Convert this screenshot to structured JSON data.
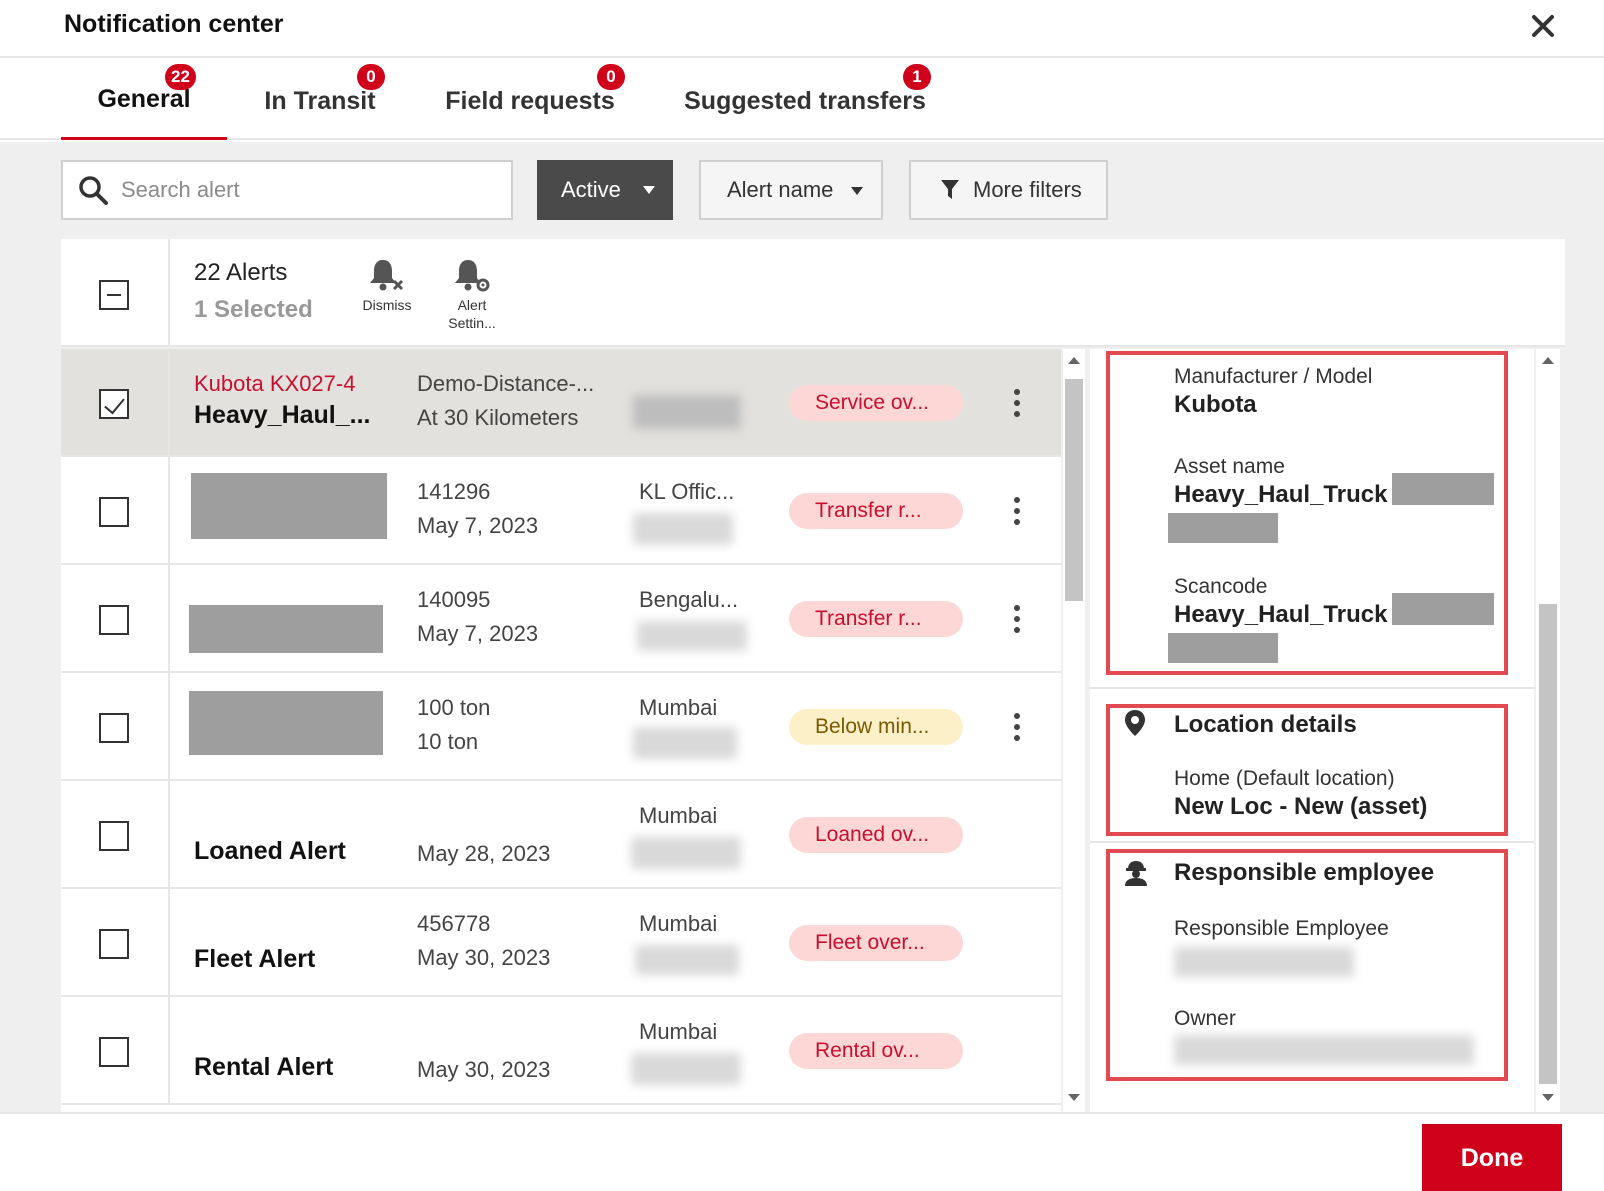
{
  "header": {
    "title": "Notification center",
    "close_icon": "close-icon"
  },
  "tabs": [
    {
      "label": "General",
      "badge": "22",
      "active": true
    },
    {
      "label": "In Transit",
      "badge": "0"
    },
    {
      "label": "Field requests",
      "badge": "0"
    },
    {
      "label": "Suggested transfers",
      "badge": "1"
    }
  ],
  "filters": {
    "search_placeholder": "Search alert",
    "status_label": "Active",
    "alert_name_label": "Alert name",
    "more_filters_label": "More filters"
  },
  "alerts_header": {
    "count": "22 Alerts",
    "selected": "1 Selected",
    "dismiss_label": "Dismiss",
    "settings_label": "Alert Settin..."
  },
  "rows": [
    {
      "title_red": "Kubota KX027-4",
      "title": "Heavy_Haul_...",
      "line1": "Demo-Distance-...",
      "line2": "At 30 Kilometers",
      "location": "",
      "status": "Service ov...",
      "status_color": "red",
      "checked": true
    },
    {
      "title": "",
      "line1": "141296",
      "line2": "May 7, 2023",
      "location": "KL Offic...",
      "status": "Transfer r...",
      "status_color": "red"
    },
    {
      "title": "",
      "line1": "140095",
      "line2": "May 7, 2023",
      "location": "Bengalu...",
      "status": "Transfer r...",
      "status_color": "red"
    },
    {
      "title": "",
      "line1": "100 ton",
      "line2": "10 ton",
      "location": "Mumbai",
      "status": "Below min...",
      "status_color": "yellow"
    },
    {
      "title": "Loaned Alert",
      "line1": "",
      "line2": "May 28, 2023",
      "location": "Mumbai",
      "status": "Loaned ov...",
      "status_color": "red"
    },
    {
      "title": "Fleet Alert",
      "line1": "456778",
      "line2": "May 30, 2023",
      "location": "Mumbai",
      "status": "Fleet over...",
      "status_color": "red"
    },
    {
      "title": "Rental Alert",
      "line1": "",
      "line2": "May 30, 2023",
      "location": "Mumbai",
      "status": "Rental ov...",
      "status_color": "red"
    }
  ],
  "detail": {
    "manufacturer_label": "Manufacturer / Model",
    "manufacturer_value": "Kubota",
    "asset_name_label": "Asset name",
    "asset_name_value": "Heavy_Haul_Truck",
    "scancode_label": "Scancode",
    "scancode_value": "Heavy_Haul_Truck",
    "location_heading": "Location details",
    "location_label": "Home (Default location)",
    "location_value": "New Loc - New (asset)",
    "responsible_heading": "Responsible employee",
    "responsible_label": "Responsible Employee",
    "owner_label": "Owner"
  },
  "footer": {
    "done_label": "Done"
  },
  "colors": {
    "accent": "#d0021b",
    "highlight_border": "#e34950",
    "pill_red_bg": "#fdd6d6",
    "pill_yellow_bg": "#fcf0c8"
  }
}
